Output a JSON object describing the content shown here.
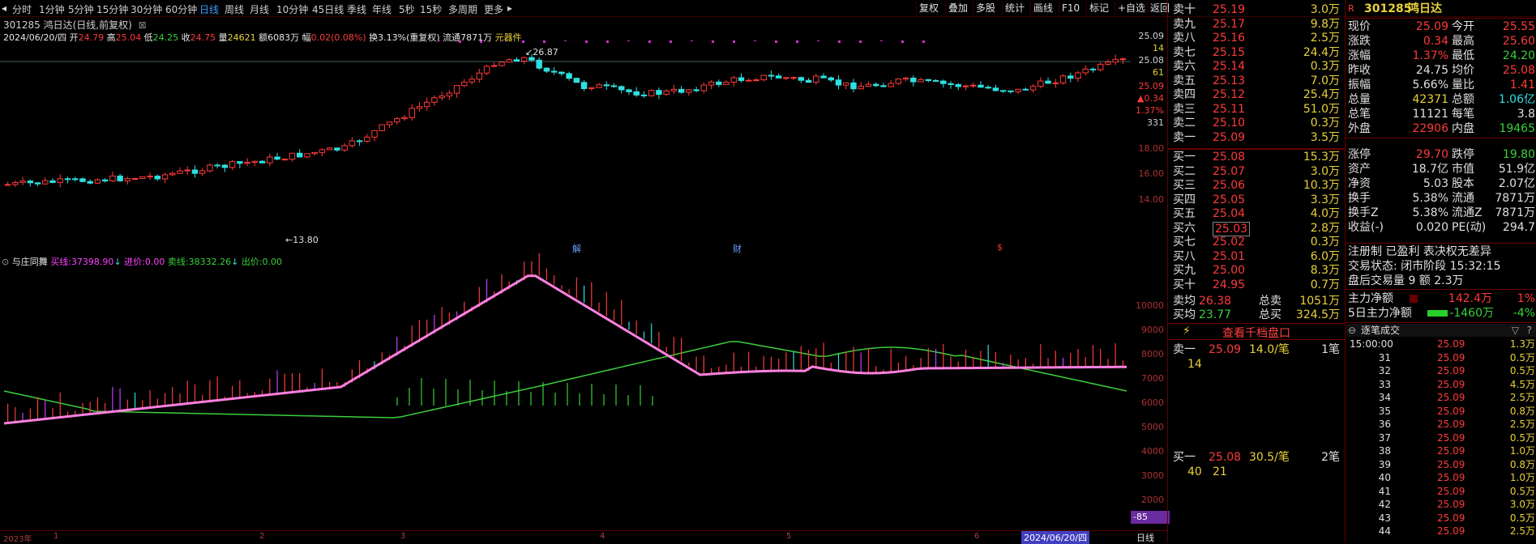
{
  "toolbar": {
    "left_items": [
      "分时",
      "1分钟",
      "5分钟",
      "15分钟",
      "30分钟",
      "60分钟",
      "日线",
      "周线",
      "月线",
      "10分钟",
      "45日线",
      "季线",
      "年线",
      "5秒",
      "15秒",
      "多周期",
      "更多"
    ],
    "active": "日线",
    "right_items": [
      "复权",
      "叠加",
      "多股",
      "统计",
      "画线",
      "F10",
      "标记",
      "+自选",
      "返回"
    ]
  },
  "header": {
    "title": "301285 鸿日达(日线,前复权)",
    "date": "2024/06/20/四",
    "open_label": "开",
    "open": "24.79",
    "high_label": "高",
    "high": "25.04",
    "low_label": "低",
    "low": "24.25",
    "close_label": "收",
    "close": "24.75",
    "volume_label": "量",
    "volume": "24621",
    "amount_label": "额",
    "amount": "6083万",
    "change_label": "幅",
    "change": "0.02(0.08%)",
    "turnover": "换3.13%(重复权)",
    "float": "流通7871万",
    "sector": "元器件"
  },
  "main_axis": {
    "labels": [
      "25.09",
      "14",
      "25.08",
      "61",
      "25.09",
      "▲0.34",
      "1.37%",
      "331",
      "18.00",
      "16.00",
      "14.00"
    ],
    "max_label": "26.87",
    "min_label": "13.80",
    "markers": [
      "解",
      "财",
      "$"
    ]
  },
  "indicator": {
    "name": "与庄同舞",
    "l1_label": "买线:",
    "l1_value": "37398.90",
    "l2_label": "进价:",
    "l2_value": "0.00",
    "l3_label": "卖线:",
    "l3_value": "38332.26",
    "l4_label": "出价:",
    "l4_value": "0.00",
    "axis": [
      "10000",
      "9000",
      "8000",
      "7000",
      "6000",
      "5000",
      "4000",
      "3000",
      "2000"
    ],
    "bottom_tag": "-85"
  },
  "time_axis": {
    "ticks": [
      "2023年",
      "1",
      "2",
      "3",
      "4",
      "5",
      "6"
    ],
    "cursor_date": "2024/06/20/四",
    "period": "日线"
  },
  "quote": {
    "code": "301285",
    "name": "鸿日达",
    "sell": [
      {
        "label": "卖十",
        "price": "25.19",
        "vol": "3.0万"
      },
      {
        "label": "卖九",
        "price": "25.17",
        "vol": "9.8万"
      },
      {
        "label": "卖八",
        "price": "25.16",
        "vol": "2.5万"
      },
      {
        "label": "卖七",
        "price": "25.15",
        "vol": "24.4万"
      },
      {
        "label": "卖六",
        "price": "25.14",
        "vol": "0.3万"
      },
      {
        "label": "卖五",
        "price": "25.13",
        "vol": "7.0万"
      },
      {
        "label": "卖四",
        "price": "25.12",
        "vol": "25.4万"
      },
      {
        "label": "卖三",
        "price": "25.11",
        "vol": "51.0万"
      },
      {
        "label": "卖二",
        "price": "25.10",
        "vol": "0.3万"
      },
      {
        "label": "卖一",
        "price": "25.09",
        "vol": "3.5万"
      }
    ],
    "buy": [
      {
        "label": "买一",
        "price": "25.08",
        "vol": "15.3万"
      },
      {
        "label": "买二",
        "price": "25.07",
        "vol": "3.0万"
      },
      {
        "label": "买三",
        "price": "25.06",
        "vol": "10.3万"
      },
      {
        "label": "买四",
        "price": "25.05",
        "vol": "3.3万"
      },
      {
        "label": "买五",
        "price": "25.04",
        "vol": "4.0万"
      },
      {
        "label": "买六",
        "price": "25.03",
        "vol": "2.8万"
      },
      {
        "label": "买七",
        "price": "25.02",
        "vol": "0.3万"
      },
      {
        "label": "买八",
        "price": "25.01",
        "vol": "6.0万"
      },
      {
        "label": "买九",
        "price": "25.00",
        "vol": "8.3万"
      },
      {
        "label": "买十",
        "price": "24.95",
        "vol": "0.7万"
      }
    ],
    "avg_sell_label": "卖均",
    "avg_sell": "26.38",
    "total_sell_label": "总卖",
    "total_sell": "1051万",
    "avg_buy_label": "买均",
    "avg_buy": "23.77",
    "total_buy_label": "总买",
    "total_buy": "324.5万",
    "stats": [
      [
        "现价",
        "25.09",
        "今开",
        "25.55"
      ],
      [
        "涨跌",
        "0.34",
        "最高",
        "25.60"
      ],
      [
        "涨幅",
        "1.37%",
        "最低",
        "24.20"
      ],
      [
        "昨收",
        "24.75",
        "均价",
        "25.08"
      ],
      [
        "振幅",
        "5.66%",
        "量比",
        "1.41"
      ],
      [
        "总量",
        "42371",
        "总额",
        "1.06亿"
      ],
      [
        "总笔",
        "11121",
        "每笔",
        "3.8"
      ],
      [
        "外盘",
        "22906",
        "内盘",
        "19465"
      ],
      [
        "涨停",
        "29.70",
        "跌停",
        "19.80"
      ],
      [
        "资产",
        "18.7亿",
        "市值",
        "51.9亿"
      ],
      [
        "净资",
        "5.03",
        "股本",
        "2.07亿"
      ],
      [
        "换手",
        "5.38%",
        "流通",
        "7871万"
      ],
      [
        "换手Z",
        "5.38%",
        "流通Z",
        "7871万"
      ],
      [
        "收益(-)",
        "0.020",
        "PE(动)",
        "294.7"
      ]
    ],
    "reg_note": "注册制 已盈利 表决权无差异",
    "trade_state": "交易状态: 闭市阶段 15:32:15",
    "after_hours": "盘后交易量 9 额 2.3万",
    "main_net_label": "主力净额",
    "main_net": "142.4万",
    "main_net_pct": "1%",
    "main5_label": "5日主力净额",
    "main5": "-1460万",
    "main5_pct": "-4%",
    "view_qian": "查看千档盘口",
    "detail_title": "逐笔成交",
    "queue_sell": {
      "label": "卖一",
      "price": "25.09",
      "vol": "14.0/笔",
      "count": "1笔",
      "item": "14"
    },
    "queue_buy": {
      "label": "买一",
      "price": "25.08",
      "vol": "30.5/笔",
      "count": "2笔",
      "items": [
        "40",
        "21"
      ]
    },
    "trades": [
      {
        "t": "15:00:00",
        "p": "25.09",
        "v": "1.3万"
      },
      {
        "t": "31",
        "p": "25.09",
        "v": "0.5万"
      },
      {
        "t": "32",
        "p": "25.09",
        "v": "0.5万"
      },
      {
        "t": "33",
        "p": "25.09",
        "v": "4.5万"
      },
      {
        "t": "34",
        "p": "25.09",
        "v": "2.5万"
      },
      {
        "t": "35",
        "p": "25.09",
        "v": "0.8万"
      },
      {
        "t": "36",
        "p": "25.09",
        "v": "2.5万"
      },
      {
        "t": "37",
        "p": "25.09",
        "v": "0.5万"
      },
      {
        "t": "38",
        "p": "25.09",
        "v": "1.0万"
      },
      {
        "t": "39",
        "p": "25.09",
        "v": "0.8万"
      },
      {
        "t": "40",
        "p": "25.09",
        "v": "1.0万"
      },
      {
        "t": "41",
        "p": "25.09",
        "v": "0.5万"
      },
      {
        "t": "42",
        "p": "25.09",
        "v": "3.0万"
      },
      {
        "t": "43",
        "p": "25.09",
        "v": "0.5万"
      },
      {
        "t": "44",
        "p": "25.09",
        "v": "2.5万"
      }
    ]
  },
  "colors": {
    "up": "#ff3a3a",
    "down": "#2ee0e0",
    "ma_pink": "#ff80e0",
    "ma_green": "#3ad03a",
    "frame": "#6a0000"
  }
}
